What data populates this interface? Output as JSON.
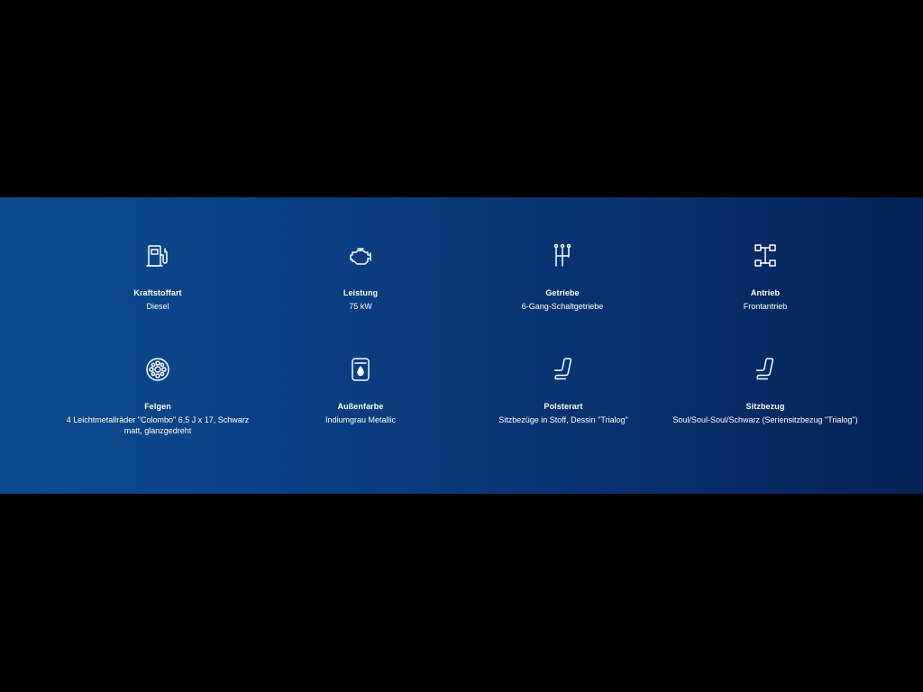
{
  "specs": [
    {
      "icon": "fuel-pump-icon",
      "label": "Kraftstoffart",
      "value": "Diesel"
    },
    {
      "icon": "engine-icon",
      "label": "Leistung",
      "value": "75 kW"
    },
    {
      "icon": "gear-shift-icon",
      "label": "Getriebe",
      "value": "6-Gang-Schaltgetriebe"
    },
    {
      "icon": "drivetrain-icon",
      "label": "Antrieb",
      "value": "Frontantrieb"
    },
    {
      "icon": "wheel-rim-icon",
      "label": "Felgen",
      "value": "4 Leichtmetallräder \"Colombo\" 6,5 J x 17, Schwarz matt, glanzgedreht"
    },
    {
      "icon": "paint-can-icon",
      "label": "Außenfarbe",
      "value": "Indiumgrau Metallic"
    },
    {
      "icon": "seat-icon",
      "label": "Polsterart",
      "value": "Sitzbezüge in Stoff, Dessin \"Trialog\""
    },
    {
      "icon": "seat-icon",
      "label": "Sitzbezug",
      "value": "Soul/Soul-Soul/Schwarz (Seriensitzbezug \"Trialog\")"
    }
  ],
  "colors": {
    "background": "#000000",
    "panel_start": "#0c4a8e",
    "panel_end": "#062257",
    "text": "#ffffff"
  }
}
